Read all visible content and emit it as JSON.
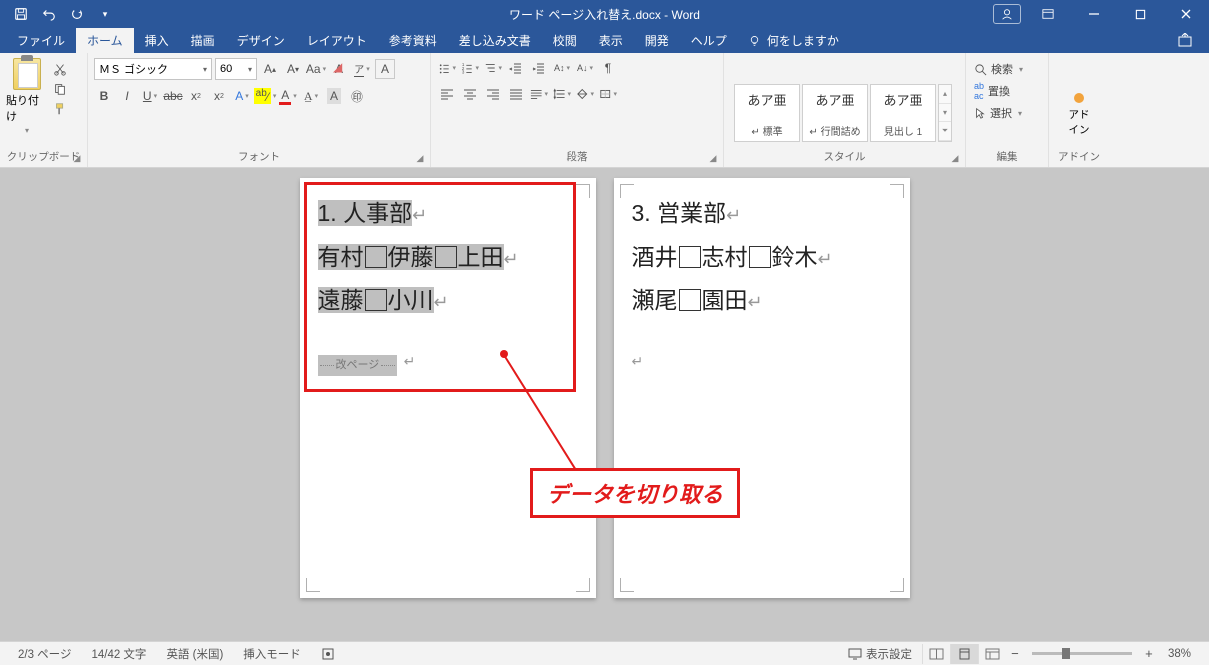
{
  "titleBar": {
    "docTitle": "ワード ページ入れ替え.docx  -  Word"
  },
  "tabs": {
    "file": "ファイル",
    "home": "ホーム",
    "insert": "挿入",
    "draw": "描画",
    "design": "デザイン",
    "layout": "レイアウト",
    "references": "参考資料",
    "mailings": "差し込み文書",
    "review": "校閲",
    "view": "表示",
    "developer": "開発",
    "help": "ヘルプ",
    "tellMe": "何をしますか"
  },
  "ribbon": {
    "clipboard": {
      "label": "クリップボード",
      "paste": "貼り付け"
    },
    "font": {
      "label": "フォント",
      "fontName": "ＭＳ ゴシック",
      "fontSize": "60"
    },
    "paragraph": {
      "label": "段落"
    },
    "styles": {
      "label": "スタイル",
      "preview": "あア亜",
      "s1": "↵ 標準",
      "s2": "↵ 行間詰め",
      "s3": "見出し 1"
    },
    "editing": {
      "label": "編集",
      "find": "検索",
      "replace": "置換",
      "select": "選択"
    },
    "addin": {
      "label": "アドイン",
      "btn": "アド\nイン"
    }
  },
  "document": {
    "page1": {
      "h": "1. 人事部",
      "l1a": "有村",
      "l1b": "伊藤",
      "l1c": "上田",
      "l2a": "遠藤",
      "l2b": "小川",
      "pageBreak": "改ページ"
    },
    "page2": {
      "h": "3. 営業部",
      "l1a": "酒井",
      "l1b": "志村",
      "l1c": "鈴木",
      "l2a": "瀬尾",
      "l2b": "園田"
    }
  },
  "annotation": {
    "text": "データを切り取る"
  },
  "statusBar": {
    "page": "2/3 ページ",
    "words": "14/42 文字",
    "lang": "英語 (米国)",
    "insertMode": "挿入モード",
    "displaySettings": "表示設定",
    "zoom": "38%"
  }
}
